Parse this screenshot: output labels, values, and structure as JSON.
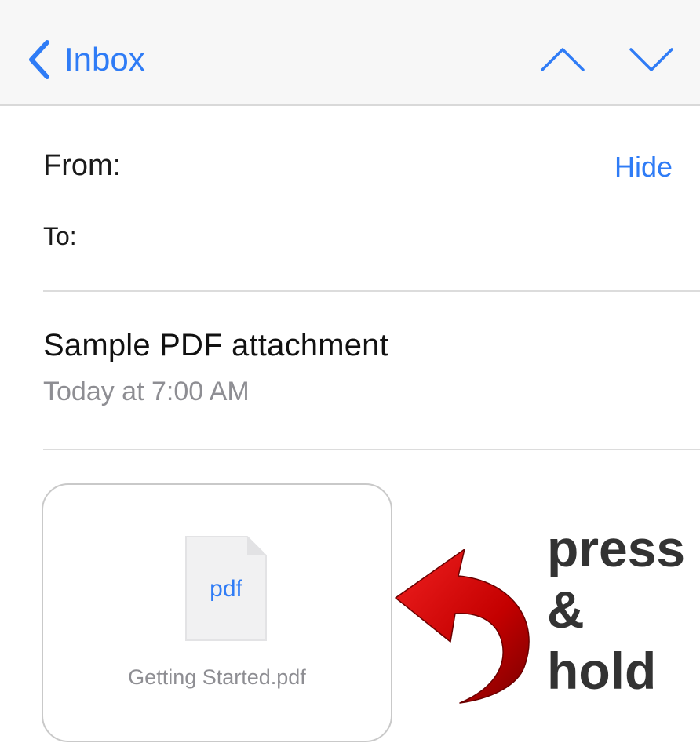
{
  "navbar": {
    "back_label": "Inbox",
    "prev_icon": "chevron-up-icon",
    "next_icon": "chevron-down-icon"
  },
  "header": {
    "from_label": "From:",
    "hide_label": "Hide",
    "to_label": "To:"
  },
  "message": {
    "subject": "Sample PDF attachment",
    "date": "Today at 7:00 AM"
  },
  "attachment": {
    "file_type": "pdf",
    "file_name": "Getting Started.pdf",
    "icon": "pdf-file-icon"
  },
  "annotation": {
    "line1": "press",
    "line2": "&",
    "line3": "hold",
    "arrow": "curved-arrow-icon"
  },
  "colors": {
    "accent": "#2f7cf6",
    "secondary_text": "#8e8e93",
    "arrow_red": "#d40000",
    "annotation_text": "#333333"
  }
}
